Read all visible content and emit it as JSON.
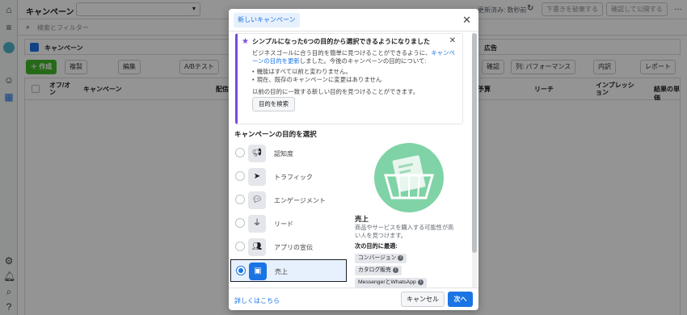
{
  "app": {
    "title": "キャンペーン"
  },
  "header": {
    "status": "更新済み: 数秒前",
    "discard_label": "下書きを破棄する",
    "publish_label": "確認して公開する",
    "more_icon": "more-icon"
  },
  "search": {
    "placeholder": "検索とフィルター"
  },
  "tabs": {
    "campaign": "キャンペーン",
    "ads": "広告"
  },
  "toolbar": {
    "create_label": "＋ 作成",
    "duplicate_label": "複製",
    "edit_label": "編集",
    "ab_test_label": "A/Bテスト",
    "columns_label": "列: パフォーマンス",
    "breakdown_label": "内訳",
    "reports_label": "レポート",
    "check_label": "確認"
  },
  "table": {
    "headers": {
      "toggle": "オフ/オン",
      "campaign": "キャンペーン",
      "delivery": "配信",
      "budget": "予算",
      "reach": "リーチ",
      "impressions": "インプレッション",
      "cost": "結果の単価"
    }
  },
  "modal": {
    "tab": "新しいキャンペーン",
    "banner": {
      "title": "シンプルになった6つの目的から選択できるようになりました",
      "p1_before": "ビジネスゴールに合う目的を簡単に見つけることができるように、",
      "p1_link": "キャンペーンの目的を更新",
      "p1_after": "しました。今後のキャンペーンの目的について:",
      "bullets": [
        "機能はすべて以前と変わりません。",
        "現在、既存のキャンペーンに変更はありません"
      ],
      "p2": "以前の目的に一致する新しい目的を見つけることができます。",
      "button": "目的を検索"
    },
    "section_title": "キャンペーンの目的を選択",
    "options": [
      {
        "label": "認知度",
        "icon": "megaphone-icon"
      },
      {
        "label": "トラフィック",
        "icon": "cursor-icon"
      },
      {
        "label": "エンゲージメント",
        "icon": "chat-bubbles-icon"
      },
      {
        "label": "リード",
        "icon": "filter-icon"
      },
      {
        "label": "アプリの宣伝",
        "icon": "people-icon"
      },
      {
        "label": "売上",
        "icon": "briefcase-icon",
        "selected": true
      }
    ],
    "detail": {
      "title": "売上",
      "description": "商品やサービスを購入する可能性が高い人を見つけます。",
      "good_for": "次の目的に最適:",
      "chips": [
        "コンバージョン",
        "カタログ販売",
        "MessengerとWhatsApp"
      ]
    },
    "footer": {
      "learn_more": "詳しくはこちら",
      "cancel": "キャンセル",
      "next": "次へ"
    }
  },
  "colors": {
    "accent": "#1b74e4",
    "create_green": "#42b72a",
    "banner_purple": "#7a4bd9",
    "illustration_green": "#7fd3a6"
  }
}
